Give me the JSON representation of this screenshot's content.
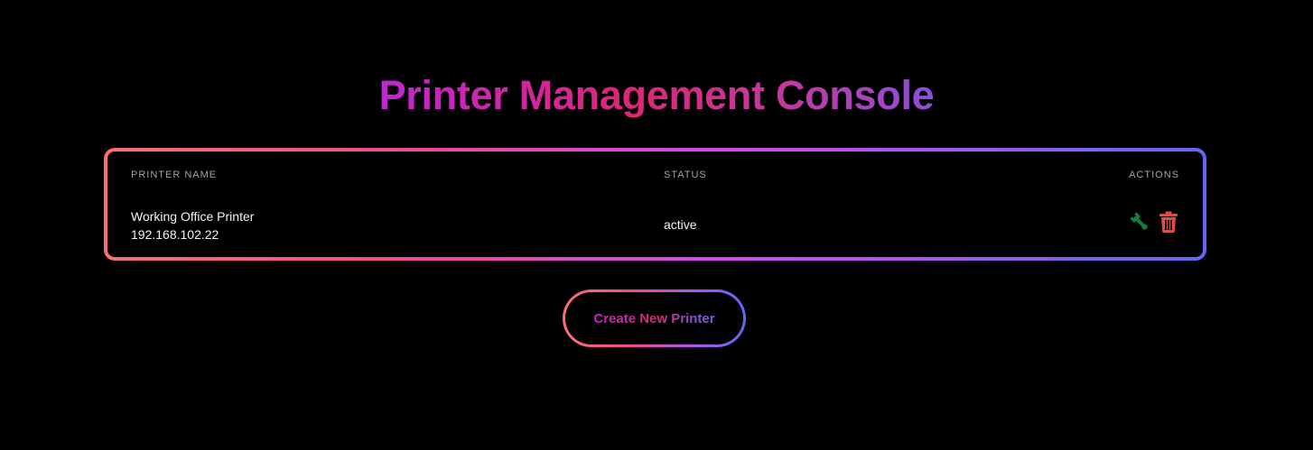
{
  "page": {
    "title": "Printer Management Console"
  },
  "table": {
    "columns": {
      "name": "PRINTER NAME",
      "status": "STATUS",
      "actions": "ACTIONS"
    },
    "rows": [
      {
        "name": "Working Office Printer",
        "ip": "192.168.102.22",
        "status": "active",
        "actions": [
          {
            "icon": "wrench-icon",
            "color": "#10803b"
          },
          {
            "icon": "trash-icon",
            "color": "#ef4444"
          }
        ]
      }
    ]
  },
  "create_button": {
    "label": "Create New Printer"
  },
  "colors": {
    "background": "#000000",
    "gradient_start": "#f87171",
    "gradient_mid": "#d946ef",
    "gradient_end": "#6366f1",
    "edit_icon": "#10803b",
    "delete_icon": "#ef4444"
  }
}
